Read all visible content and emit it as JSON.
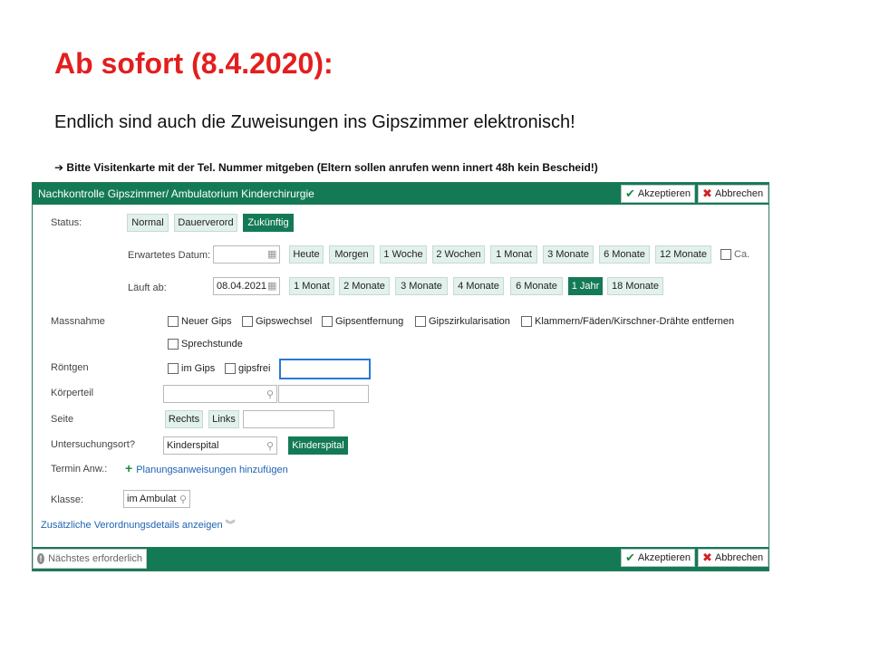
{
  "slide": {
    "title": "Ab sofort (8.4.2020):",
    "subtitle": "Endlich sind auch die Zuweisungen ins Gipszimmer elektronisch!",
    "note_arrow": "➔",
    "note": "Bitte Visitenkarte mit der Tel. Nummer mitgeben (Eltern sollen anrufen wenn innert 48h kein Bescheid!)"
  },
  "dialog": {
    "title": "Nachkontrolle Gipszimmer/ Ambulatorium Kinderchirurgie",
    "accept_label": "Akzeptieren",
    "cancel_label": "Abbrechen",
    "next_required_label": "Nächstes erforderlich",
    "status": {
      "label": "Status:",
      "options": [
        "Normal",
        "Dauerverord",
        "Zukünftig"
      ],
      "selected": "Zukünftig"
    },
    "expected_date": {
      "label": "Erwartetes Datum:",
      "value": "",
      "quick": [
        "Heute",
        "Morgen",
        "1 Woche",
        "2 Wochen",
        "1 Monat",
        "3 Monate",
        "6 Monate",
        "12 Monate"
      ],
      "ca_label": "Ca."
    },
    "expires": {
      "label": "Läuft ab:",
      "value": "08.04.2021",
      "quick": [
        "1 Monat",
        "2 Monate",
        "3 Monate",
        "4 Monate",
        "6 Monate",
        "1 Jahr",
        "18 Monate"
      ],
      "selected": "1 Jahr"
    },
    "measure": {
      "label": "Massnahme",
      "options": [
        "Neuer Gips",
        "Gipswechsel",
        "Gipsentfernung",
        "Gipszirkularisation",
        "Klammern/Fäden/Kirschner-Drähte entfernen",
        "Sprechstunde"
      ]
    },
    "xray": {
      "label": "Röntgen",
      "options": [
        "im Gips",
        "gipsfrei"
      ],
      "value": ""
    },
    "body_part": {
      "label": "Körperteil",
      "value": "",
      "value2": ""
    },
    "side": {
      "label": "Seite",
      "options": [
        "Rechts",
        "Links"
      ],
      "value": ""
    },
    "location": {
      "label": "Untersuchungsort?",
      "value": "Kinderspital",
      "selected": "Kinderspital"
    },
    "appointment": {
      "label": "Termin Anw.:",
      "link": "Planungsanweisungen hinzufügen"
    },
    "class": {
      "label": "Klasse:",
      "value": "im Ambulat"
    },
    "more_details": "Zusätzliche Verordnungsdetails anzeigen"
  },
  "colors": {
    "accent": "#147a55",
    "title_red": "#e31e1e",
    "link": "#1e63b4",
    "focus": "#2a78d6"
  }
}
